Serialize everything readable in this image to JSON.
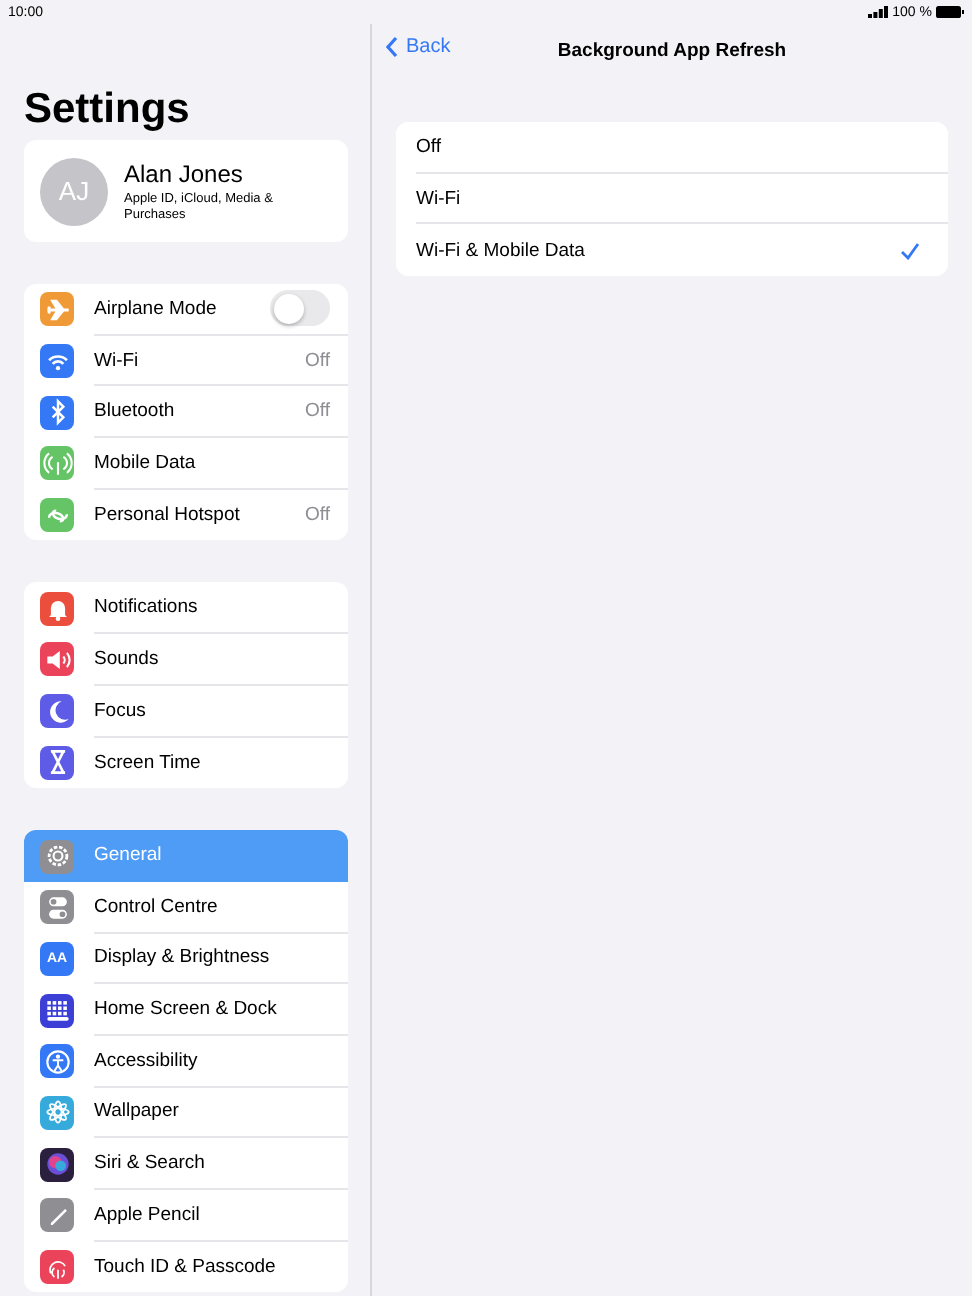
{
  "status_bar": {
    "time": "10:00",
    "battery": "100 %"
  },
  "sidebar": {
    "title": "Settings",
    "profile": {
      "initials": "AJ",
      "name": "Alan Jones",
      "subtitle": "Apple ID, iCloud, Media & Purchases"
    },
    "groups": [
      {
        "items": [
          {
            "label": "Airplane Mode",
            "kind": "toggle",
            "on": false,
            "color": "#f09a37",
            "selected": false
          },
          {
            "label": "Wi-Fi",
            "kind": "value",
            "detail": "Off",
            "color": "#3478f6",
            "selected": false
          },
          {
            "label": "Bluetooth",
            "kind": "value",
            "detail": "Off",
            "color": "#3478f6",
            "selected": false
          },
          {
            "label": "Mobile Data",
            "kind": "plain",
            "color": "#65c466",
            "selected": false
          },
          {
            "label": "Personal Hotspot",
            "kind": "value",
            "detail": "Off",
            "color": "#65c466",
            "selected": false
          }
        ]
      },
      {
        "items": [
          {
            "label": "Notifications",
            "kind": "plain",
            "color": "#eb4e3d",
            "selected": false
          },
          {
            "label": "Sounds",
            "kind": "plain",
            "color": "#eb445a",
            "selected": false
          },
          {
            "label": "Focus",
            "kind": "plain",
            "color": "#5e5ce6",
            "selected": false
          },
          {
            "label": "Screen Time",
            "kind": "plain",
            "color": "#5e5ce6",
            "selected": false
          }
        ]
      },
      {
        "items": [
          {
            "label": "General",
            "kind": "plain",
            "color": "#8e8e93",
            "selected": true
          },
          {
            "label": "Control Centre",
            "kind": "plain",
            "color": "#8e8e93",
            "selected": false
          },
          {
            "label": "Display & Brightness",
            "kind": "plain",
            "color": "#3478f6",
            "icon_text": "AA",
            "selected": false
          },
          {
            "label": "Home Screen & Dock",
            "kind": "plain",
            "color": "#3c3fd6",
            "selected": false
          },
          {
            "label": "Accessibility",
            "kind": "plain",
            "color": "#3478f6",
            "selected": false
          },
          {
            "label": "Wallpaper",
            "kind": "plain",
            "color": "#37aadc",
            "selected": false
          },
          {
            "label": "Siri & Search",
            "kind": "plain",
            "color": "#2a1f3d",
            "selected": false
          },
          {
            "label": "Apple Pencil",
            "kind": "plain",
            "color": "#8e8e93",
            "selected": false
          },
          {
            "label": "Touch ID & Passcode",
            "kind": "plain",
            "color": "#eb445a",
            "selected": false
          }
        ]
      }
    ]
  },
  "detail": {
    "back": "Back",
    "title": "Background App Refresh",
    "options": [
      {
        "label": "Off",
        "selected": false
      },
      {
        "label": "Wi-Fi",
        "selected": false
      },
      {
        "label": "Wi-Fi & Mobile Data",
        "selected": true
      }
    ]
  }
}
